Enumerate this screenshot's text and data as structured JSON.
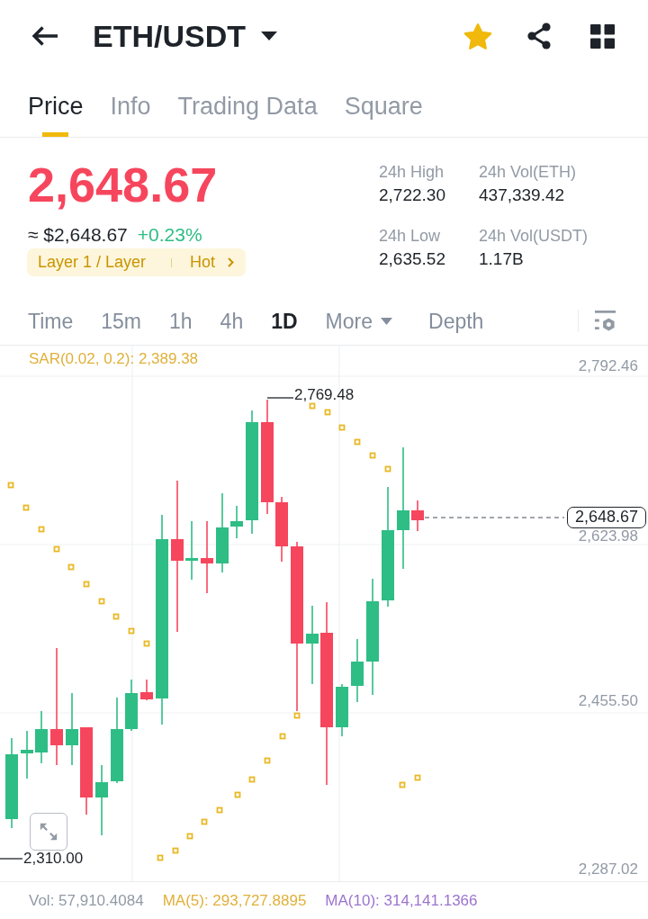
{
  "header": {
    "title": "ETH/USDT",
    "favorite": true
  },
  "tabs": [
    {
      "label": "Price",
      "selected": true
    },
    {
      "label": "Info",
      "selected": false
    },
    {
      "label": "Trading Data",
      "selected": false
    },
    {
      "label": "Square",
      "selected": false
    }
  ],
  "ticker": {
    "last_price": "2,648.67",
    "approx_price": "≈ $2,648.67",
    "change": "+0.23%",
    "sector": "Layer 1 / Layer",
    "badge": "Hot"
  },
  "stats": [
    {
      "label": "24h High",
      "value": "2,722.30"
    },
    {
      "label": "24h Vol(ETH)",
      "value": "437,339.42"
    },
    {
      "label": "24h Low",
      "value": "2,635.52"
    },
    {
      "label": "24h Vol(USDT)",
      "value": "1.17B"
    }
  ],
  "intervals": [
    {
      "label": "Time",
      "selected": false,
      "kind": "interval"
    },
    {
      "label": "15m",
      "selected": false,
      "kind": "interval"
    },
    {
      "label": "1h",
      "selected": false,
      "kind": "interval"
    },
    {
      "label": "4h",
      "selected": false,
      "kind": "interval"
    },
    {
      "label": "1D",
      "selected": true,
      "kind": "interval"
    },
    {
      "label": "More",
      "selected": false,
      "kind": "menu"
    },
    {
      "label": "Depth",
      "selected": false,
      "kind": "view"
    }
  ],
  "chart": {
    "indicator_legend": "SAR(0.02, 0.2): 2,389.38",
    "price_axis_labels": [
      "2,792.46",
      "2,623.98",
      "2,455.50",
      "2,287.02"
    ],
    "high_label": "2,769.48",
    "low_label": "2,310.00",
    "current_price": "2,648.67"
  },
  "indicator_values": [
    {
      "text": "Vol: 57,910.4084",
      "color": "#929aa5"
    },
    {
      "text": "MA(5): 293,727.8895",
      "color": "#e0b03a"
    },
    {
      "text": "MA(10): 314,141.1366",
      "color": "#9b74cf"
    }
  ]
}
